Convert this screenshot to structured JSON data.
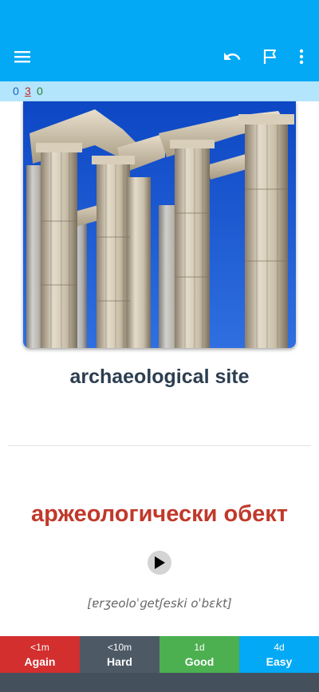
{
  "toolbar": {
    "icons": [
      "menu-icon",
      "undo-icon",
      "flag-icon",
      "more-vert-icon"
    ],
    "color": "#03a9f4"
  },
  "counts": {
    "new": "0",
    "learning": "3",
    "review": "0"
  },
  "card": {
    "image": "temple-columns-image",
    "term": "archaeological site",
    "translation": "аржеологически обект",
    "ipa": "[ɐrʒeoloˈɡetʃeski oˈbɛkt]"
  },
  "answers": [
    {
      "interval": "<1m",
      "label": "Again",
      "color": "#d32f2f"
    },
    {
      "interval": "<10m",
      "label": "Hard",
      "color": "#4d5a66"
    },
    {
      "interval": "1d",
      "label": "Good",
      "color": "#4caf50"
    },
    {
      "interval": "4d",
      "label": "Easy",
      "color": "#03a9f4"
    }
  ]
}
